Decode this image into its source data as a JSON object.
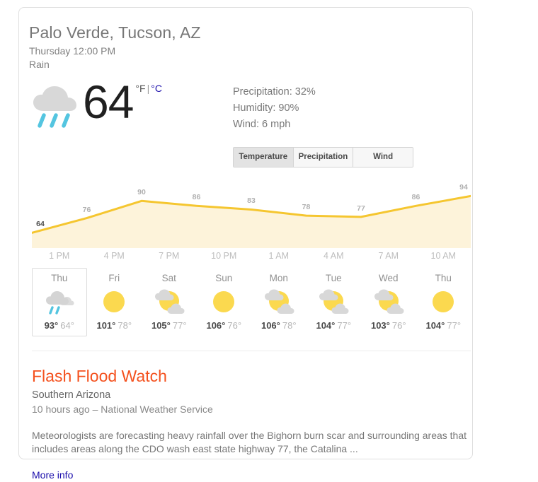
{
  "card": {
    "location": "Palo Verde, Tucson, AZ",
    "datetime": "Thursday 12:00 PM",
    "condition": "Rain",
    "condition_icon": "rain-icon"
  },
  "current": {
    "temperature": "64",
    "unit_f": "°F",
    "unit_separator": "|",
    "unit_c": "°C",
    "precipitation": "Precipitation: 32%",
    "humidity": "Humidity: 90%",
    "wind": "Wind: 6 mph"
  },
  "mode_tabs": [
    {
      "label": "Temperature",
      "active": true
    },
    {
      "label": "Precipitation",
      "active": false
    },
    {
      "label": "Wind",
      "active": false
    }
  ],
  "chart_data": {
    "type": "area",
    "title": "",
    "xlabel": "",
    "ylabel": "",
    "ylim": [
      55,
      100
    ],
    "grid": false,
    "legend": "none",
    "line_color": "#F5C630",
    "fill_color": "#FDF3DA",
    "categories": [
      "1 PM",
      "4 PM",
      "7 PM",
      "10 PM",
      "1 AM",
      "4 AM",
      "7 AM",
      "10 AM"
    ],
    "point_labels": [
      "64",
      "76",
      "90",
      "86",
      "83",
      "78",
      "77",
      "86",
      "94"
    ],
    "values": [
      64,
      76,
      90,
      86,
      83,
      78,
      77,
      86,
      94
    ],
    "current_index": 0
  },
  "daily": [
    {
      "day": "Thu",
      "icon": "rain-icon",
      "high": "93°",
      "low": "64°",
      "selected": true
    },
    {
      "day": "Fri",
      "icon": "sunny-icon",
      "high": "101°",
      "low": "78°",
      "selected": false
    },
    {
      "day": "Sat",
      "icon": "partly-cloudy-icon",
      "high": "105°",
      "low": "77°",
      "selected": false
    },
    {
      "day": "Sun",
      "icon": "sunny-icon",
      "high": "106°",
      "low": "76°",
      "selected": false
    },
    {
      "day": "Mon",
      "icon": "partly-cloudy-icon",
      "high": "106°",
      "low": "78°",
      "selected": false
    },
    {
      "day": "Tue",
      "icon": "partly-cloudy-icon",
      "high": "104°",
      "low": "77°",
      "selected": false
    },
    {
      "day": "Wed",
      "icon": "partly-cloudy-icon",
      "high": "103°",
      "low": "76°",
      "selected": false
    },
    {
      "day": "Thu",
      "icon": "sunny-icon",
      "high": "104°",
      "low": "77°",
      "selected": false
    }
  ],
  "alert": {
    "title": "Flash Flood Watch",
    "region": "Southern Arizona",
    "meta": "10 hours ago – National Weather Service",
    "body": "Meteorologists are forecasting heavy rainfall over the Bighorn burn scar and surrounding areas that includes areas along the CDO wash east state highway 77, the Catalina ...",
    "more_label": "More info"
  }
}
